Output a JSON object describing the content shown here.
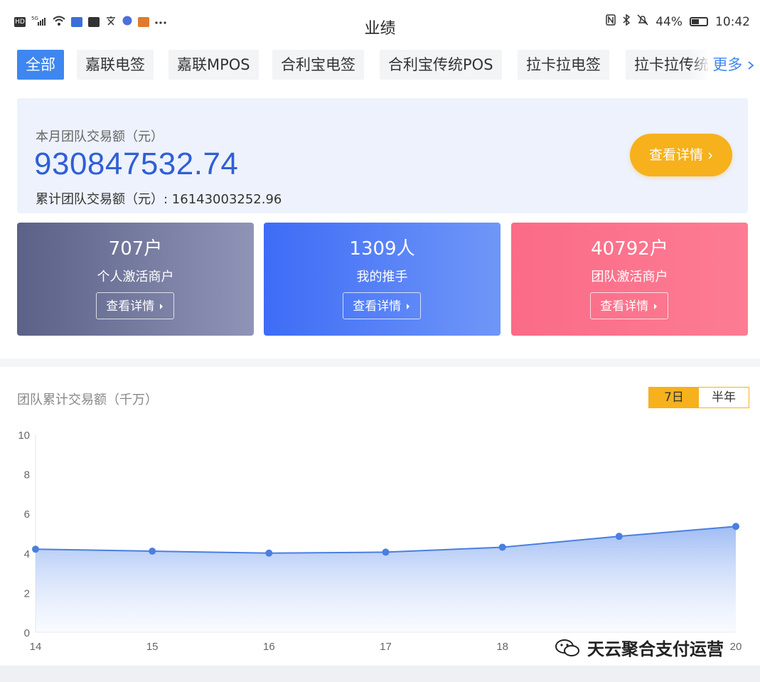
{
  "status_bar": {
    "left_icons": [
      "HD",
      "5G",
      "signal",
      "wifi",
      "app-icon",
      "app-icon",
      "text-icon",
      "music-icon",
      "app-icon",
      "more-dots"
    ],
    "battery": "44%",
    "time": "10:42"
  },
  "header": {
    "title": "业绩"
  },
  "tabs": {
    "items": [
      {
        "label": "全部",
        "active": true
      },
      {
        "label": "嘉联电签",
        "active": false
      },
      {
        "label": "嘉联MPOS",
        "active": false
      },
      {
        "label": "合利宝电签",
        "active": false
      },
      {
        "label": "合利宝传统POS",
        "active": false
      },
      {
        "label": "拉卡拉电签",
        "active": false
      },
      {
        "label": "拉卡拉传统",
        "active": false
      }
    ],
    "more_label": "更多",
    "active_color": "#3e87f0"
  },
  "summary": {
    "month_label": "本月团队交易额（元）",
    "month_amount": "930847532.74",
    "total_label": "累计团队交易额（元）: 16143003252.96",
    "detail_button": "查看详情"
  },
  "cards": [
    {
      "value": "707户",
      "label": "个人激活商户",
      "button": "查看详情"
    },
    {
      "value": "1309人",
      "label": "我的推手",
      "button": "查看详情"
    },
    {
      "value": "40792户",
      "label": "团队激活商户",
      "button": "查看详情"
    }
  ],
  "chart": {
    "title": "团队累计交易额（千万）",
    "toggle": [
      {
        "label": "7日",
        "active": true
      },
      {
        "label": "半年",
        "active": false
      }
    ]
  },
  "chart_data": {
    "type": "area",
    "title": "团队累计交易额（千万）",
    "x": [
      "14",
      "15",
      "16",
      "17",
      "18",
      "19",
      "20"
    ],
    "series": [
      {
        "values": [
          4.2,
          4.1,
          4.0,
          4.05,
          4.3,
          4.85,
          5.35
        ]
      }
    ],
    "ylim": [
      0,
      10
    ],
    "yticks": [
      "0",
      "2",
      "4",
      "6",
      "8",
      "10"
    ],
    "xticks": [
      "14",
      "15",
      "16",
      "17",
      "18",
      "20"
    ],
    "grid": false,
    "line_color": "#4a7fe0"
  },
  "watermark": {
    "text": "天云聚合支付运营"
  }
}
